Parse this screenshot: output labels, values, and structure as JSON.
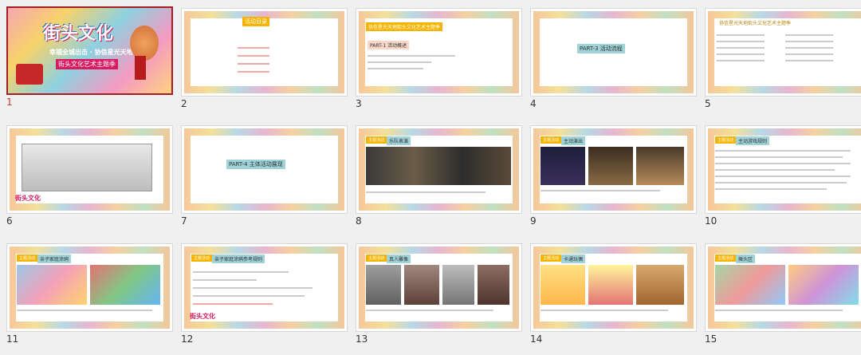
{
  "slides": [
    {
      "number": "1",
      "selected": true,
      "title": "街头文化",
      "subtitle": "幸福全城出击 · 协信星光天地",
      "theme": "街头文化艺术主题季"
    },
    {
      "number": "2",
      "heading": "活动目录"
    },
    {
      "number": "3",
      "title": "协信星光天地街头文化艺术主题季",
      "section": "PART-1 活动概述"
    },
    {
      "number": "4",
      "section": "PART-3 活动流程"
    },
    {
      "number": "5",
      "title": "协信星光天地街头文化艺术主题季"
    },
    {
      "number": "6"
    },
    {
      "number": "7",
      "section": "PART-4 主体活动展现"
    },
    {
      "number": "8",
      "tag": "主题活动",
      "heading": "乐队表演"
    },
    {
      "number": "9",
      "tag": "主题活动",
      "heading": "主动演出"
    },
    {
      "number": "10",
      "tag": "主题活动",
      "heading": "主动游戏规则"
    },
    {
      "number": "11",
      "tag": "主题活动",
      "heading": "亲子家庭涂鸦"
    },
    {
      "number": "12",
      "tag": "主题活动",
      "heading": "亲子家庭涂鸦参考规则"
    },
    {
      "number": "13",
      "tag": "主题活动",
      "heading": "真人雕像"
    },
    {
      "number": "14",
      "tag": "主题活动",
      "heading": "卡通玩偶"
    },
    {
      "number": "15",
      "tag": "主题活动",
      "heading": "摊头区"
    }
  ],
  "brand": {
    "name": "街头文化",
    "accent": "#d81b60",
    "select": "#a31f24"
  }
}
